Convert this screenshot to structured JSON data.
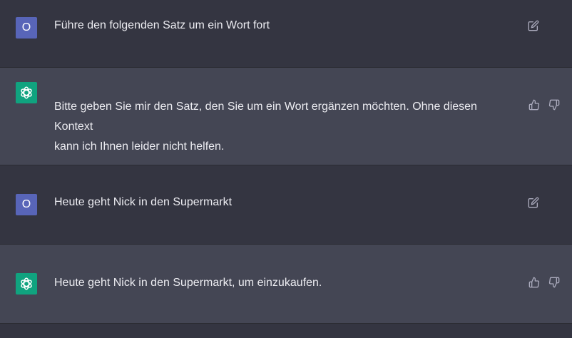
{
  "conversation": [
    {
      "role": "user",
      "avatar_letter": "O",
      "text": "Führe den folgenden Satz um ein Wort fort",
      "actions": [
        "edit-icon"
      ]
    },
    {
      "role": "assistant",
      "text_lines": [
        "Bitte geben Sie mir den Satz, den Sie um ein Wort ergänzen möchten. Ohne diesen Kontext",
        "kann ich Ihnen leider nicht helfen."
      ],
      "actions": [
        "thumbs-up-icon",
        "thumbs-down-icon"
      ]
    },
    {
      "role": "user",
      "avatar_letter": "O",
      "text": "Heute geht Nick in den Supermarkt",
      "actions": [
        "edit-icon"
      ]
    },
    {
      "role": "assistant",
      "text_lines": [
        "Heute geht Nick in den Supermarkt, um einzukaufen."
      ],
      "actions": [
        "thumbs-up-icon",
        "thumbs-down-icon"
      ]
    }
  ],
  "colors": {
    "user_bg": "#343541",
    "assistant_bg": "#444654",
    "user_avatar": "#5865b8",
    "assistant_avatar": "#10a37f",
    "text": "#ececf1",
    "icon": "#acacbe"
  }
}
